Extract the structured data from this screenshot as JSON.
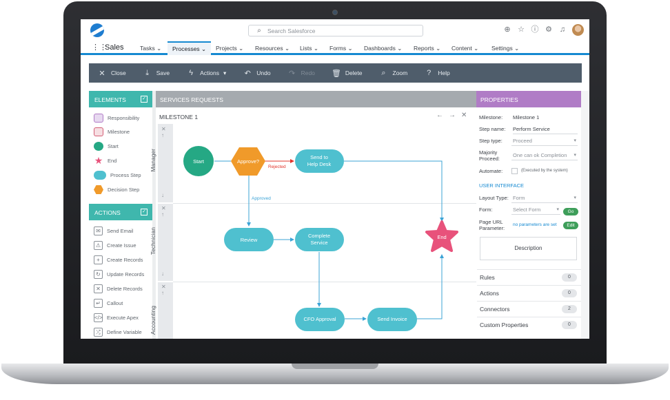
{
  "top": {
    "search_placeholder": "Search Salesforce",
    "icons": [
      "add-icon",
      "star-icon",
      "help-icon",
      "gear-icon",
      "bell-icon"
    ]
  },
  "nav": {
    "app_name": "Sales",
    "items": [
      "Tasks",
      "Processes",
      "Projects",
      "Resources",
      "Lists",
      "Forms",
      "Dashboards",
      "Reports",
      "Content",
      "Settings"
    ],
    "active": "Processes"
  },
  "toolbar": {
    "close": "Close",
    "save": "Save",
    "actions": "Actions",
    "undo": "Undo",
    "redo": "Redo",
    "delete": "Delete",
    "zoom": "Zoom",
    "help": "Help"
  },
  "elements": {
    "title": "ELEMENTS",
    "items": [
      "Responsibility",
      "Milestone",
      "Start",
      "End",
      "Process Step",
      "Decision Step"
    ]
  },
  "actions_panel": {
    "title": "ACTIONS",
    "items": [
      "Send Email",
      "Create Issue",
      "Create Records",
      "Update Records",
      "Delete Records",
      "Callout",
      "Execute Apex",
      "Define Variable"
    ]
  },
  "canvas": {
    "title": "SERVICES REQUESTS",
    "milestone": "MILESTONE 1",
    "lanes": [
      "Manager",
      "Technician",
      "Accounting"
    ],
    "nodes": {
      "start": "Start",
      "approve": "Approve?",
      "send_help": [
        "Send to",
        "Help Desk"
      ],
      "review": "Review",
      "complete": [
        "Complete",
        "Service"
      ],
      "end": "End",
      "cfo": "CFO Approval",
      "invoice": "Send Invoice"
    },
    "rejected": "Rejected",
    "approved": "Approved"
  },
  "properties": {
    "title": "PROPERTIES",
    "milestone_label": "Milestone:",
    "milestone_value": "Milestone 1",
    "step_name_label": "Step name:",
    "step_name_value": "Perform Service",
    "step_type_label": "Step type:",
    "step_type_value": "Proceed",
    "majority_label_1": "Majority",
    "majority_label_2": "Proceed:",
    "majority_value": "One can ok Completion",
    "automate_label": "Automate:",
    "automate_note": "(Executed by the system)",
    "ui_section": "USER INTERFACE",
    "layout_label": "Layout Type:",
    "layout_value": "Form",
    "form_label": "Form:",
    "form_value": "Select Form",
    "go": "Go",
    "url_label_1": "Page URL",
    "url_label_2": "Parameter:",
    "url_value": "no parameters are set",
    "edit": "Edit",
    "description": "Description",
    "sections": [
      {
        "name": "Rules",
        "count": "0"
      },
      {
        "name": "Actions",
        "count": "0"
      },
      {
        "name": "Connectors",
        "count": "2"
      },
      {
        "name": "Custom Properties",
        "count": "0"
      }
    ]
  }
}
